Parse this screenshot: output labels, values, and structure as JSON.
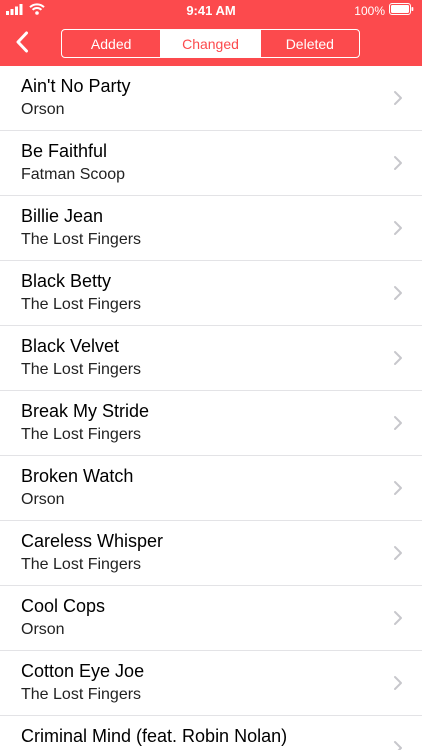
{
  "status_bar": {
    "time": "9:41 AM",
    "battery": "100%",
    "icons": [
      "signal-icon",
      "wifi-icon",
      "battery-icon"
    ]
  },
  "nav": {
    "back_icon": "chevron-left-icon",
    "segments": [
      {
        "label": "Added",
        "selected": false
      },
      {
        "label": "Changed",
        "selected": true
      },
      {
        "label": "Deleted",
        "selected": false
      }
    ]
  },
  "colors": {
    "accent": "#fc4a4d",
    "separator": "#e3e3e6",
    "chevron": "#c7c7cc"
  },
  "songs": [
    {
      "title": "Ain't No Party",
      "artist": "Orson"
    },
    {
      "title": "Be Faithful",
      "artist": "Fatman Scoop"
    },
    {
      "title": "Billie Jean",
      "artist": "The Lost Fingers"
    },
    {
      "title": "Black Betty",
      "artist": "The Lost Fingers"
    },
    {
      "title": "Black Velvet",
      "artist": "The Lost Fingers"
    },
    {
      "title": "Break My Stride",
      "artist": "The Lost Fingers"
    },
    {
      "title": "Broken Watch",
      "artist": "Orson"
    },
    {
      "title": "Careless Whisper",
      "artist": "The Lost Fingers"
    },
    {
      "title": "Cool Cops",
      "artist": "Orson"
    },
    {
      "title": "Cotton Eye Joe",
      "artist": "The Lost Fingers"
    },
    {
      "title": "Criminal Mind (feat. Robin Nolan)",
      "artist": ""
    }
  ]
}
